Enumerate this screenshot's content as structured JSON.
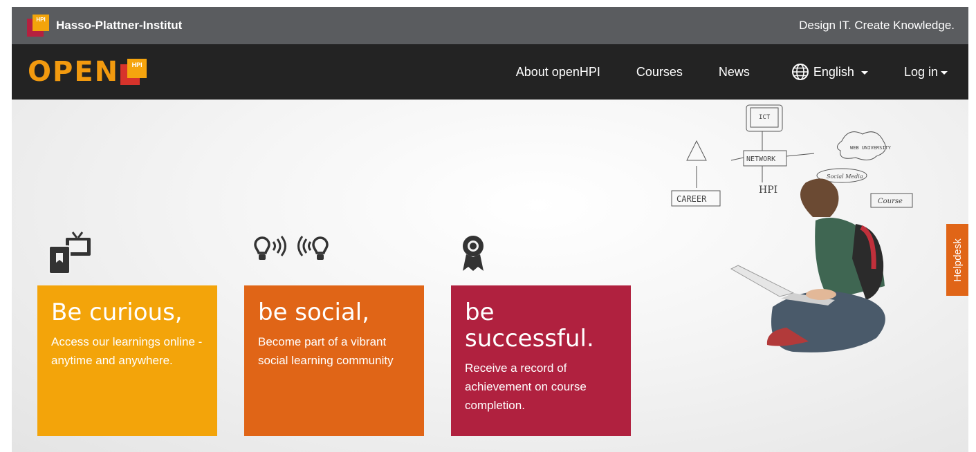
{
  "topbar": {
    "logo_text": "HPI",
    "institute": "Hasso-Plattner-Institut",
    "slogan": "Design IT. Create Knowledge."
  },
  "navbar": {
    "logo_word": "OPEN",
    "logo_badge": "HPI",
    "items": {
      "about": "About openHPI",
      "courses": "Courses",
      "news": "News",
      "language": "English",
      "login": "Log in"
    }
  },
  "hero": {
    "cards": [
      {
        "title": "Be curious,",
        "text": "Access our learnings online - anytime and anywhere.",
        "color": "#f3a40a"
      },
      {
        "title": "be social,",
        "text": "Become part of a vibrant social learning community",
        "color": "#e06517"
      },
      {
        "title": "be successful.",
        "text": "Receive a record of achievement on course completion.",
        "color": "#b0213f"
      }
    ],
    "icons": [
      "devices-icon",
      "lightbulbs-broadcast-icon",
      "award-ribbon-icon"
    ],
    "sketch": {
      "ict": "ICT",
      "network": "NETWORK",
      "career": "CAREER",
      "web": "WEB UNIVERSITY",
      "social_media": "Social Media",
      "course": "Course",
      "hpi": "HPI"
    }
  },
  "helpdesk": {
    "label": "Helpdesk",
    "color": "#e06517"
  }
}
